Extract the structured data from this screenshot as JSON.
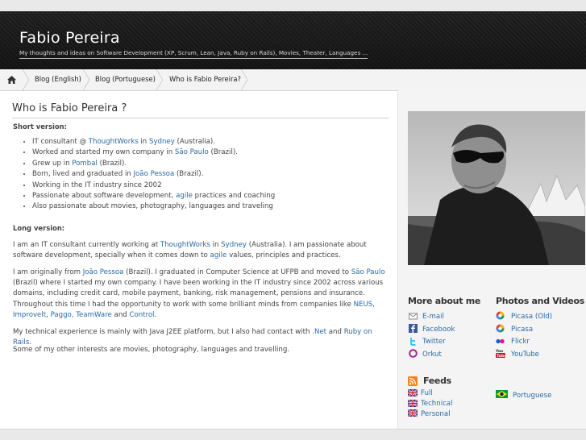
{
  "header": {
    "title": "Fabio Pereira",
    "tagline": "My thoughts and ideas on Software Development (XP, Scrum, Lean, Java, Ruby on Rails), Movies, Theater, Languages ..."
  },
  "breadcrumb": {
    "items": [
      {
        "label": "Blog (English)"
      },
      {
        "label": "Blog (Portuguese)"
      },
      {
        "label": "Who is Fabio Pereira?"
      }
    ]
  },
  "main": {
    "title": "Who is Fabio Pereira ?",
    "short_heading": "Short version:",
    "short_list": [
      {
        "pre": "IT consultant @ ",
        "link1": "ThoughtWorks",
        "mid": " in ",
        "link2": "Sydney",
        "post": " (Australia)."
      },
      {
        "pre": "Worked and started my own company in ",
        "link1": "São Paulo",
        "post": " (Brazil)."
      },
      {
        "pre": "Grew up in ",
        "link1": "Pombal",
        "post": " (Brazil)."
      },
      {
        "pre": "Born, lived and graduated in ",
        "link1": "João Pessoa",
        "post": " (Brazil)."
      },
      {
        "pre": "Working in the IT industry since 2002"
      },
      {
        "pre": "Passionate about software development, ",
        "link1": "agile",
        "post": " practices and coaching"
      },
      {
        "pre": "Also passionate about movies, photography, languages and traveling"
      }
    ],
    "long_heading": "Long version:",
    "p1": {
      "a": "I am an IT consultant currently working at ",
      "l1": "ThoughtWorks",
      "b": " in ",
      "l2": "Sydney",
      "c": " (Australia). I am passionate about software development, specially when it comes down to ",
      "l3": "agile",
      "d": " values, principles and practices."
    },
    "p2": {
      "a": "I am originally from ",
      "l1": "João Pessoa",
      "b": " (Brazil). I graduated in Computer Science at UFPB and moved to ",
      "l2": "São Paulo",
      "c": " (Brazil) where I started my own company. I have been working in the IT industry since 2002 across various domains, including credit card, mobile payment, banking, risk management, pensions and insurance. Throughout this time I had the opportunity to work with some brilliant minds from companies like ",
      "l3": "NEUS",
      "d": ", ",
      "l4": "Improvelt",
      "e": ", ",
      "l5": "Paggo",
      "f": ", ",
      "l6": "TeamWare",
      "g": " and ",
      "l7": "Control",
      "h": "."
    },
    "p3": {
      "a": "My technical experience is mainly with Java J2EE platform, but I also had contact with ",
      "l1": ".Net",
      "b": " and ",
      "l2": "Ruby on Rails",
      "c": "."
    },
    "p4": "Some of my other interests are movies, photography, languages and travelling."
  },
  "sidebar": {
    "more_heading": "More about me",
    "more_links": [
      {
        "label": "E-mail",
        "icon": "mail-icon"
      },
      {
        "label": "Facebook",
        "icon": "facebook-icon"
      },
      {
        "label": "Twitter",
        "icon": "twitter-icon"
      },
      {
        "label": "Orkut",
        "icon": "orkut-icon"
      }
    ],
    "photos_heading": "Photos and Videos",
    "photo_links": [
      {
        "label": "Picasa (Old)",
        "icon": "picasa-icon"
      },
      {
        "label": "Picasa",
        "icon": "picasa-icon"
      },
      {
        "label": "Flickr",
        "icon": "flickr-icon"
      },
      {
        "label": "YouTube",
        "icon": "youtube-icon"
      }
    ],
    "feeds_heading": "Feeds",
    "feed_links": [
      {
        "label": "Full",
        "icon": "uk-flag-icon"
      },
      {
        "label": "Technical",
        "icon": "uk-flag-icon"
      },
      {
        "label": "Personal",
        "icon": "uk-flag-icon"
      }
    ],
    "portuguese_link": {
      "label": "Portuguese",
      "icon": "brazil-flag-icon"
    }
  },
  "colors": {
    "link": "#2a6aa5",
    "header_bg": "#222222",
    "sidebar_bg": "#f4f4f4"
  }
}
